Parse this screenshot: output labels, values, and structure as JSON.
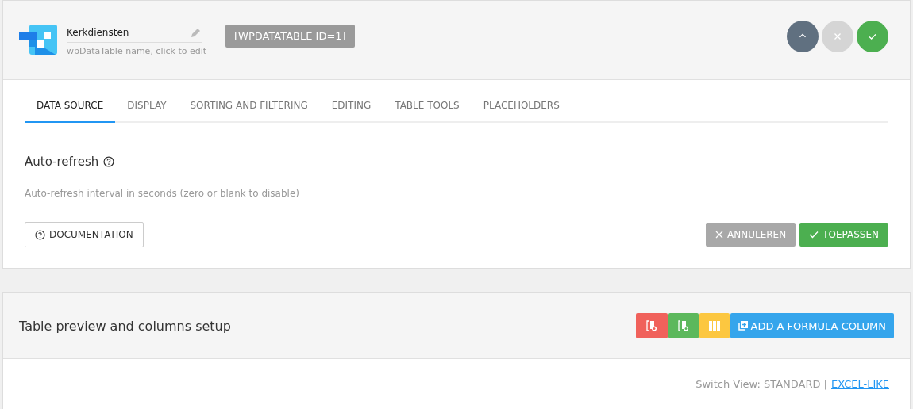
{
  "header": {
    "table_name": "Kerkdiensten",
    "name_hint": "wpDataTable name, click to edit",
    "shortcode": "[WPDATATABLE ID=1]",
    "actions": [
      {
        "kind": "collapse"
      },
      {
        "kind": "close"
      },
      {
        "kind": "save"
      }
    ]
  },
  "tabs": [
    {
      "label": "DATA SOURCE",
      "selected": true
    },
    {
      "label": "DISPLAY",
      "selected": false
    },
    {
      "label": "SORTING AND FILTERING",
      "selected": false
    },
    {
      "label": "EDITING",
      "selected": false
    },
    {
      "label": "TABLE TOOLS",
      "selected": false
    },
    {
      "label": "PLACEHOLDERS",
      "selected": false
    }
  ],
  "auto_refresh": {
    "title": "Auto-refresh",
    "placeholder": "Auto-refresh interval in seconds (zero or blank to disable)"
  },
  "documentation_button": "DOCUMENTATION",
  "cancel_button": {
    "label": "ANNULEREN",
    "disabled": true
  },
  "apply_button": "TOEPASSEN",
  "preview": {
    "title": "Table preview and columns setup",
    "buttons": [
      {
        "kind": "remove-column"
      },
      {
        "kind": "add-column"
      },
      {
        "kind": "columns"
      },
      {
        "kind": "formula",
        "label": "ADD A FORMULA COLUMN"
      }
    ],
    "switch_view": {
      "label": "Switch View: STANDARD |",
      "link": "EXCEL-LIKE"
    }
  }
}
